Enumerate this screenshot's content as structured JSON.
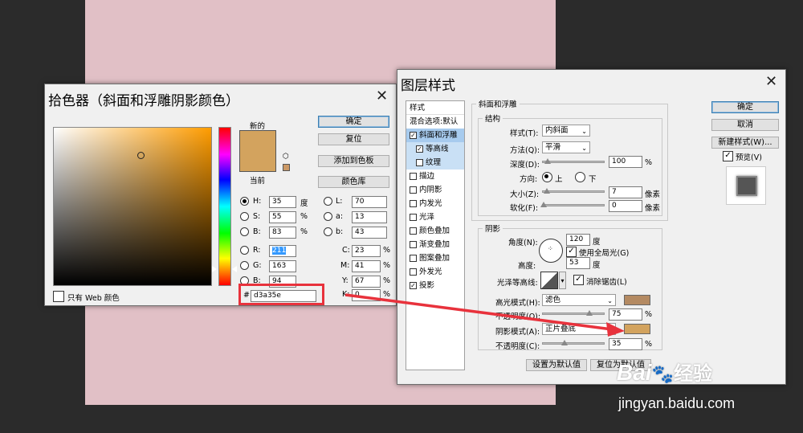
{
  "color_picker": {
    "title": "拾色器（斜面和浮雕阴影颜色）",
    "new_label": "新的",
    "current_label": "当前",
    "new_color": "#d3a35e",
    "buttons": {
      "ok": "确定",
      "reset": "复位",
      "add_swatch": "添加到色板",
      "color_library": "颜色库"
    },
    "fields": {
      "H": {
        "label": "H:",
        "value": "35",
        "unit": "度"
      },
      "S": {
        "label": "S:",
        "value": "55",
        "unit": "%"
      },
      "Bv": {
        "label": "B:",
        "value": "83",
        "unit": "%"
      },
      "R": {
        "label": "R:",
        "value": "211"
      },
      "G": {
        "label": "G:",
        "value": "163"
      },
      "Bc": {
        "label": "B:",
        "value": "94"
      },
      "L": {
        "label": "L:",
        "value": "70"
      },
      "a": {
        "label": "a:",
        "value": "13"
      },
      "b": {
        "label": "b:",
        "value": "43"
      },
      "C": {
        "label": "C:",
        "value": "23",
        "unit": "%"
      },
      "M": {
        "label": "M:",
        "value": "41",
        "unit": "%"
      },
      "Y": {
        "label": "Y:",
        "value": "67",
        "unit": "%"
      },
      "K": {
        "label": "K:",
        "value": "0",
        "unit": "%"
      }
    },
    "hex_label": "#",
    "hex_value": "d3a35e",
    "web_only_label": "只有 Web 颜色",
    "highlight_color": "#e8323c"
  },
  "layer_style": {
    "title": "图层样式",
    "styles_header": "样式",
    "blend_default": "混合选项:默认",
    "styles": [
      {
        "label": "斜面和浮雕",
        "checked": true,
        "kind": "sel"
      },
      {
        "label": "等高线",
        "checked": true,
        "kind": "sub"
      },
      {
        "label": "纹理",
        "checked": false,
        "kind": "sub"
      },
      {
        "label": "描边",
        "checked": false,
        "kind": ""
      },
      {
        "label": "内阴影",
        "checked": false,
        "kind": ""
      },
      {
        "label": "内发光",
        "checked": false,
        "kind": ""
      },
      {
        "label": "光泽",
        "checked": false,
        "kind": ""
      },
      {
        "label": "颜色叠加",
        "checked": false,
        "kind": ""
      },
      {
        "label": "渐变叠加",
        "checked": false,
        "kind": ""
      },
      {
        "label": "图案叠加",
        "checked": false,
        "kind": ""
      },
      {
        "label": "外发光",
        "checked": false,
        "kind": ""
      },
      {
        "label": "投影",
        "checked": true,
        "kind": ""
      }
    ],
    "bevel_group": "斜面和浮雕",
    "structure_group": "结构",
    "style_label": "样式(T):",
    "style_value": "内斜面",
    "method_label": "方法(Q):",
    "method_value": "平滑",
    "depth_label": "深度(D):",
    "depth_value": "100",
    "depth_unit": "%",
    "direction_label": "方向:",
    "dir_up": "上",
    "dir_down": "下",
    "size_label": "大小(Z):",
    "size_value": "7",
    "size_unit": "像素",
    "soften_label": "软化(F):",
    "soften_value": "0",
    "soften_unit": "像素",
    "shading_group": "阴影",
    "angle_label": "角度(N):",
    "angle_value": "120",
    "angle_unit": "度",
    "global_light_label": "使用全局光(G)",
    "altitude_label": "高度:",
    "altitude_value": "53",
    "altitude_unit": "度",
    "gloss_label": "光泽等高线:",
    "antialias_label": "消除锯齿(L)",
    "highlight_mode_label": "高光模式(H):",
    "highlight_mode_value": "滤色",
    "highlight_color": "#b48a62",
    "hl_opacity_label": "不透明度(O):",
    "hl_opacity_value": "75",
    "shadow_mode_label": "阴影模式(A):",
    "shadow_mode_value": "正片叠底",
    "shadow_color": "#d3a35e",
    "sh_opacity_label": "不透明度(C):",
    "sh_opacity_value": "35",
    "percent": "%",
    "set_default": "设置为默认值",
    "reset_default": "复位为默认值",
    "ok": "确定",
    "cancel": "取消",
    "new_style": "新建样式(W)...",
    "preview_label": "预览(V)"
  },
  "watermark": {
    "brand": "Bai",
    "brand2": "经验",
    "url": "jingyan.baidu.com"
  }
}
